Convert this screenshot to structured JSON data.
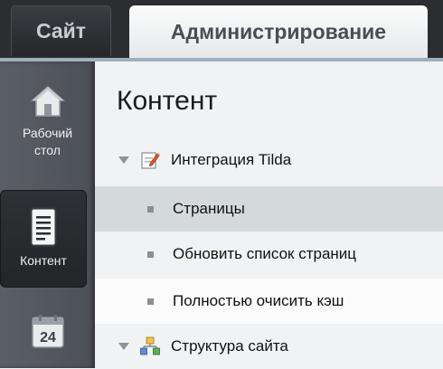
{
  "tabs": {
    "site": "Сайт",
    "admin": "Администрирование"
  },
  "sidebar": {
    "items": [
      {
        "label": "Рабочий стол",
        "icon": "home-icon"
      },
      {
        "label": "Контент",
        "icon": "document-icon"
      },
      {
        "label": "",
        "icon": "calendar-icon",
        "badge": "24"
      }
    ]
  },
  "main": {
    "title": "Контент",
    "tree": [
      {
        "label": "Интеграция Tilda",
        "icon": "edit-note-icon",
        "type": "group"
      },
      {
        "label": "Страницы",
        "type": "item",
        "selected": true
      },
      {
        "label": "Обновить список страниц",
        "type": "item"
      },
      {
        "label": "Полностью очисить кэш",
        "type": "item"
      },
      {
        "label": "Структура сайта",
        "icon": "site-structure-icon",
        "type": "group"
      }
    ]
  },
  "colors": {
    "topbar": "#2b2d31",
    "accent_line": "#9fb0bd",
    "selected_row": "#d4d9dc"
  }
}
